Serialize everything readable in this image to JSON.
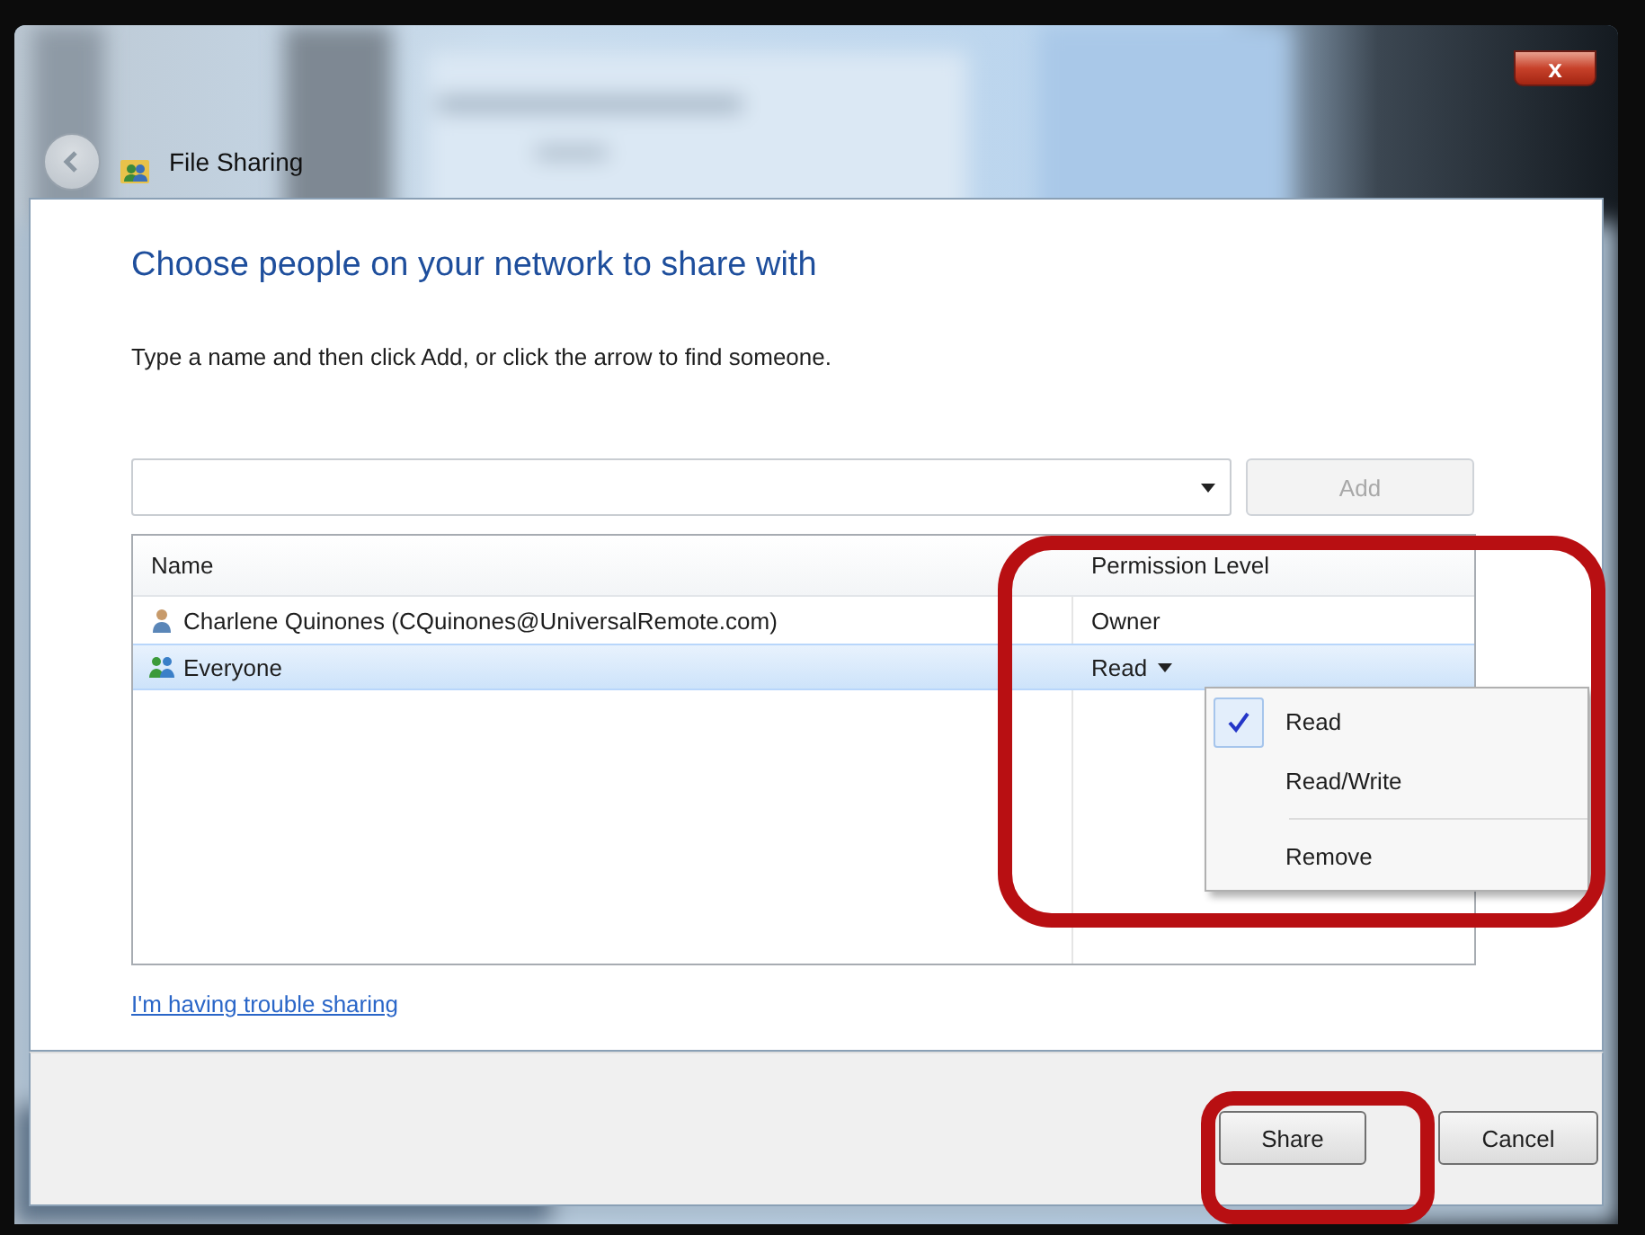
{
  "window": {
    "title": "File Sharing",
    "close_button": "x"
  },
  "heading": "Choose people on your network to share with",
  "instructions": "Type a name and then click Add, or click the arrow to find someone.",
  "add_button": {
    "label": "Add",
    "disabled": true
  },
  "table": {
    "columns": [
      "Name",
      "Permission Level"
    ],
    "rows": [
      {
        "name": "Charlene Quinones (CQuinones@UniversalRemote.com)",
        "kind": "user",
        "permission": "Owner",
        "has_menu": false,
        "selected": false
      },
      {
        "name": "Everyone",
        "kind": "group",
        "permission": "Read",
        "has_menu": true,
        "selected": true
      }
    ]
  },
  "permission_menu": {
    "items": [
      {
        "kind": "option",
        "label": "Read",
        "checked": true
      },
      {
        "kind": "option",
        "label": "Read/Write",
        "checked": false
      },
      {
        "kind": "separator"
      },
      {
        "kind": "option",
        "label": "Remove",
        "checked": false
      }
    ]
  },
  "help_link": "I'm having trouble sharing",
  "buttons": [
    {
      "label": "Share"
    },
    {
      "label": "Cancel"
    }
  ],
  "highlights": [
    {
      "kind": "rounded_frame"
    },
    {
      "kind": "rounded_frame"
    }
  ]
}
